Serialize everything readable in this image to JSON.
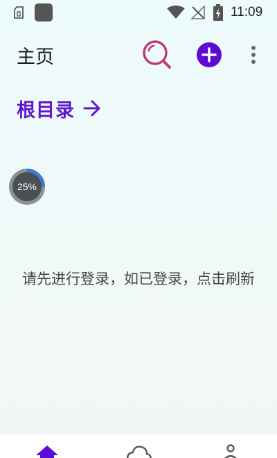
{
  "status_bar": {
    "time": "11:09",
    "icons": [
      "sim-card-icon",
      "app-square-icon",
      "wifi-icon",
      "no-signal-icon",
      "battery-charging-icon"
    ]
  },
  "app_bar": {
    "title": "主页",
    "actions": [
      "search-icon",
      "add-icon",
      "more-vert-icon"
    ],
    "search_color": "#c0397a",
    "add_color": "#5c0ad6"
  },
  "breadcrumb": {
    "label": "根目录",
    "icon": "arrow-right-icon",
    "color": "#6016d0"
  },
  "progress": {
    "percent_text": "25%",
    "value": 0.25,
    "accent": "#3a7bd5"
  },
  "message": "请先进行登录，如已登录，点击刷新",
  "bottom_nav": {
    "items": [
      {
        "icon": "home-icon",
        "active": true
      },
      {
        "icon": "cloud-icon",
        "active": false
      },
      {
        "icon": "profile-icon",
        "active": false
      }
    ],
    "active_color": "#5c0ad6"
  }
}
